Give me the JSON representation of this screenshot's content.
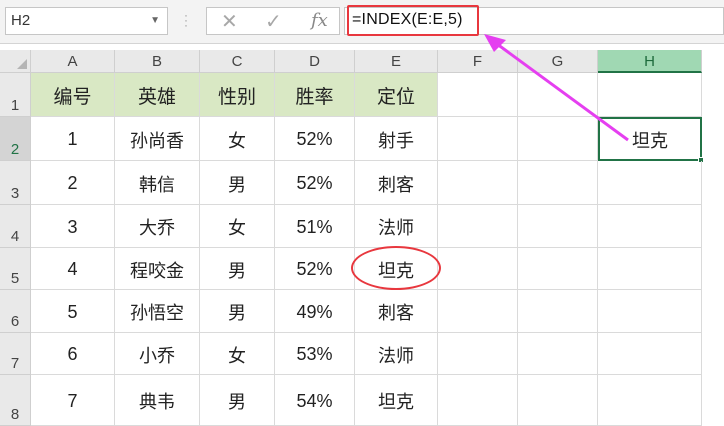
{
  "name_box": {
    "value": "H2"
  },
  "formula_bar": {
    "formula": "=INDEX(E:E,5)",
    "cancel_icon": "cancel-x-icon",
    "enter_icon": "checkmark-icon",
    "function_icon": "fx-icon",
    "cancel_glyph": "✕",
    "enter_glyph": "✓",
    "fx_glyph": "fx"
  },
  "columns": [
    "A",
    "B",
    "C",
    "D",
    "E",
    "F",
    "G",
    "H"
  ],
  "rows": [
    "1",
    "2",
    "3",
    "4",
    "5",
    "6",
    "7",
    "8"
  ],
  "selected_cell": {
    "column": "H",
    "row": "2"
  },
  "headers": [
    "编号",
    "英雄",
    "性别",
    "胜率",
    "定位"
  ],
  "data_rows": [
    [
      "1",
      "孙尚香",
      "女",
      "52%",
      "射手"
    ],
    [
      "2",
      "韩信",
      "男",
      "52%",
      "刺客"
    ],
    [
      "3",
      "大乔",
      "女",
      "51%",
      "法师"
    ],
    [
      "4",
      "程咬金",
      "男",
      "52%",
      "坦克"
    ],
    [
      "5",
      "孙悟空",
      "男",
      "49%",
      "刺客"
    ],
    [
      "6",
      "小乔",
      "女",
      "53%",
      "法师"
    ],
    [
      "7",
      "典韦",
      "男",
      "54%",
      "坦克"
    ]
  ],
  "result_cell": {
    "value": "坦克"
  },
  "colors": {
    "header_fill": "#d9e8c4",
    "selection": "#217346",
    "annotation_red": "#e8373e",
    "arrow_magenta": "#e53ff0"
  }
}
